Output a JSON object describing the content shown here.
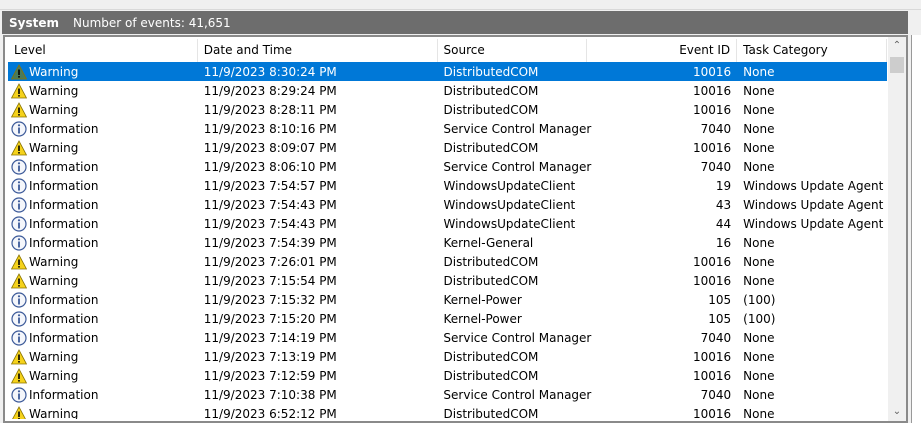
{
  "header": {
    "title": "System",
    "event_count": "Number of events: 41,651"
  },
  "columns": [
    "Level",
    "Date and Time",
    "Source",
    "Event ID",
    "Task Category"
  ],
  "rows": [
    {
      "level": "Warning",
      "icon": "warning",
      "date": "11/9/2023 8:30:24 PM",
      "source": "DistributedCOM",
      "id": "10016",
      "cat": "None",
      "selected": true
    },
    {
      "level": "Warning",
      "icon": "warning",
      "date": "11/9/2023 8:29:24 PM",
      "source": "DistributedCOM",
      "id": "10016",
      "cat": "None"
    },
    {
      "level": "Warning",
      "icon": "warning",
      "date": "11/9/2023 8:28:11 PM",
      "source": "DistributedCOM",
      "id": "10016",
      "cat": "None"
    },
    {
      "level": "Information",
      "icon": "info",
      "date": "11/9/2023 8:10:16 PM",
      "source": "Service Control Manager",
      "id": "7040",
      "cat": "None"
    },
    {
      "level": "Warning",
      "icon": "warning",
      "date": "11/9/2023 8:09:07 PM",
      "source": "DistributedCOM",
      "id": "10016",
      "cat": "None"
    },
    {
      "level": "Information",
      "icon": "info",
      "date": "11/9/2023 8:06:10 PM",
      "source": "Service Control Manager",
      "id": "7040",
      "cat": "None"
    },
    {
      "level": "Information",
      "icon": "info",
      "date": "11/9/2023 7:54:57 PM",
      "source": "WindowsUpdateClient",
      "id": "19",
      "cat": "Windows Update Agent"
    },
    {
      "level": "Information",
      "icon": "info",
      "date": "11/9/2023 7:54:43 PM",
      "source": "WindowsUpdateClient",
      "id": "43",
      "cat": "Windows Update Agent"
    },
    {
      "level": "Information",
      "icon": "info",
      "date": "11/9/2023 7:54:43 PM",
      "source": "WindowsUpdateClient",
      "id": "44",
      "cat": "Windows Update Agent"
    },
    {
      "level": "Information",
      "icon": "info",
      "date": "11/9/2023 7:54:39 PM",
      "source": "Kernel-General",
      "id": "16",
      "cat": "None"
    },
    {
      "level": "Warning",
      "icon": "warning",
      "date": "11/9/2023 7:26:01 PM",
      "source": "DistributedCOM",
      "id": "10016",
      "cat": "None"
    },
    {
      "level": "Warning",
      "icon": "warning",
      "date": "11/9/2023 7:15:54 PM",
      "source": "DistributedCOM",
      "id": "10016",
      "cat": "None"
    },
    {
      "level": "Information",
      "icon": "info",
      "date": "11/9/2023 7:15:32 PM",
      "source": "Kernel-Power",
      "id": "105",
      "cat": "(100)"
    },
    {
      "level": "Information",
      "icon": "info",
      "date": "11/9/2023 7:15:20 PM",
      "source": "Kernel-Power",
      "id": "105",
      "cat": "(100)"
    },
    {
      "level": "Information",
      "icon": "info",
      "date": "11/9/2023 7:14:19 PM",
      "source": "Service Control Manager",
      "id": "7040",
      "cat": "None"
    },
    {
      "level": "Warning",
      "icon": "warning",
      "date": "11/9/2023 7:13:19 PM",
      "source": "DistributedCOM",
      "id": "10016",
      "cat": "None"
    },
    {
      "level": "Warning",
      "icon": "warning",
      "date": "11/9/2023 7:12:59 PM",
      "source": "DistributedCOM",
      "id": "10016",
      "cat": "None"
    },
    {
      "level": "Information",
      "icon": "info",
      "date": "11/9/2023 7:10:38 PM",
      "source": "Service Control Manager",
      "id": "7040",
      "cat": "None"
    },
    {
      "level": "Warning",
      "icon": "warning",
      "date": "11/9/2023 6:52:12 PM",
      "source": "DistributedCOM",
      "id": "10016",
      "cat": "None"
    }
  ],
  "colors": {
    "selection": "#0078d7",
    "titlebar": "#6d6d6d",
    "warning": "#f5d21b",
    "info": "#3c5a99"
  }
}
